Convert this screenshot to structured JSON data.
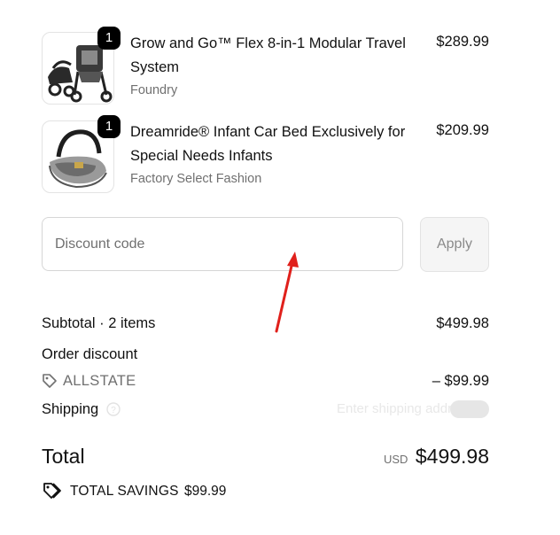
{
  "cart": {
    "items": [
      {
        "quantity": "1",
        "title": "Grow and Go™ Flex 8-in-1 Modular Travel System",
        "vendor": "Foundry",
        "price": "$289.99",
        "image": "stroller-travel-system-image"
      },
      {
        "quantity": "1",
        "title": "Dreamride® Infant Car Bed Exclusively for Special Needs Infants",
        "vendor": "Factory Select Fashion",
        "price": "$209.99",
        "image": "infant-car-bed-image"
      }
    ]
  },
  "discount": {
    "placeholder": "Discount code",
    "apply_label": "Apply"
  },
  "summary": {
    "subtotal_label": "Subtotal · 2 items",
    "subtotal_value": "$499.98",
    "order_discount_label": "Order discount",
    "discount_code": "ALLSTATE",
    "discount_value": "– $99.99",
    "shipping_label": "Shipping",
    "shipping_hint": "Enter shipping address",
    "total_label": "Total",
    "currency": "USD",
    "total_value": "$499.98",
    "savings_label": "TOTAL SAVINGS",
    "savings_value": "$99.99"
  },
  "colors": {
    "annotation_arrow": "#e0201b",
    "badge": "#000000"
  }
}
